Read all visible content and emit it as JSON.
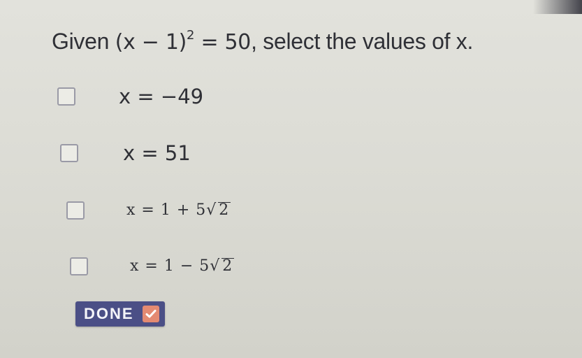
{
  "question": {
    "prefix": "Given ",
    "equation_base": "(x − 1)",
    "equation_exponent": "2",
    "equation_rest": " = 50",
    "suffix": ", select the values of x."
  },
  "options": [
    {
      "text": "x = −49",
      "checked": false
    },
    {
      "text": "x = 51",
      "checked": false
    },
    {
      "prefix": "x = 1 + 5",
      "radicand": "2",
      "checked": false
    },
    {
      "prefix": "x = 1 − 5",
      "radicand": "2",
      "checked": false
    }
  ],
  "done_button": {
    "label": "DONE",
    "icon": "checkmark-icon",
    "icon_color": "#e48a72"
  },
  "colors": {
    "background": "#dcdcd5",
    "button": "#4b4f86",
    "text": "#2f3036"
  }
}
